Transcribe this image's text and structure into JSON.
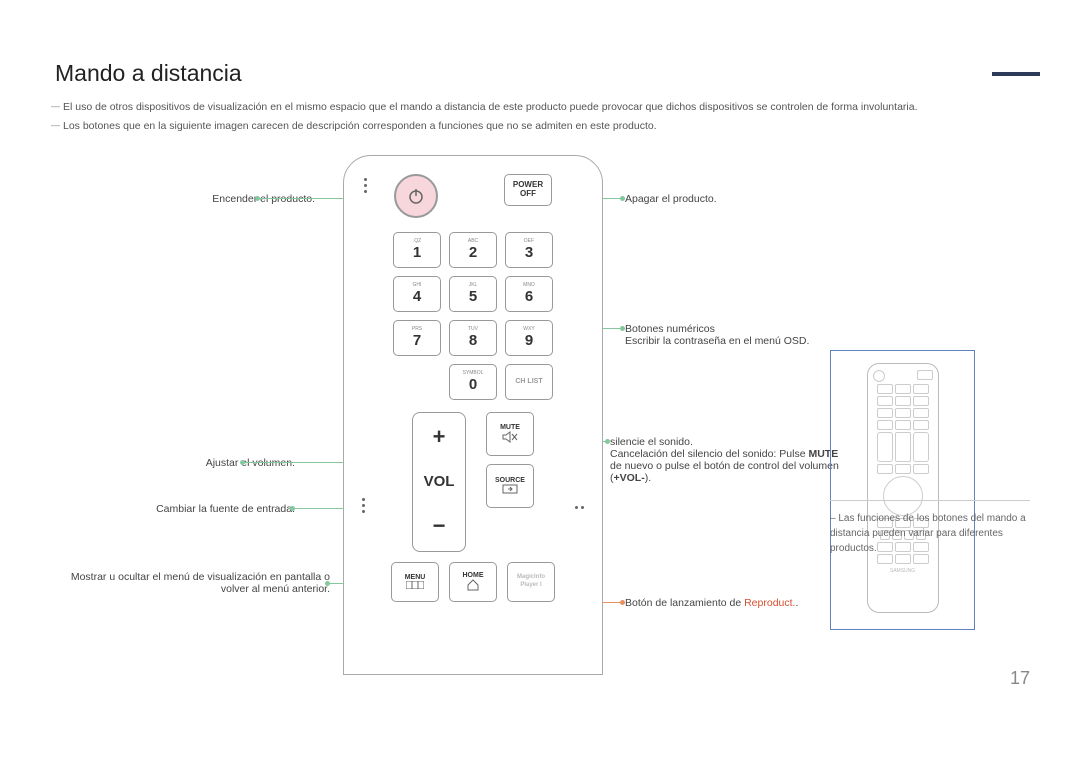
{
  "title": "Mando a distancia",
  "notes": [
    "El uso de otros dispositivos de visualización en el mismo espacio que el mando a distancia de este producto puede provocar que dichos dispositivos se controlen de forma involuntaria.",
    "Los botones que en la siguiente imagen carecen de descripción corresponden a funciones que no se admiten en este producto."
  ],
  "labels_left": {
    "power_on": "Encender el producto.",
    "volume": "Ajustar el volumen.",
    "source": "Cambiar la fuente de entrada.",
    "menu": "Mostrar u ocultar el menú de visualización en pantalla o volver al menú anterior."
  },
  "labels_right": {
    "power_off": "Apagar el producto.",
    "numeric_title": "Botones numéricos",
    "numeric_desc": "Escribir la contraseña en el menú OSD.",
    "mute_title": "silencie el sonido.",
    "mute_desc1": "Cancelación del silencio del sonido: Pulse ",
    "mute_bold": "MUTE",
    "mute_desc2": " de nuevo o pulse el botón de control del volumen (",
    "mute_vol": "+VOL-",
    "mute_desc3": ").",
    "magicinfo": "Botón de lanzamiento de ",
    "magicinfo_hi": "Reproduct.",
    "magicinfo_end": "."
  },
  "buttons": {
    "power_off": "POWER OFF",
    "k1_sub": ".QZ",
    "k1": "1",
    "k2_sub": "ABC",
    "k2": "2",
    "k3_sub": "DEF",
    "k3": "3",
    "k4_sub": "GHI",
    "k4": "4",
    "k5_sub": "JKL",
    "k5": "5",
    "k6_sub": "MNO",
    "k6": "6",
    "k7_sub": "PRS",
    "k7": "7",
    "k8_sub": "TUV",
    "k8": "8",
    "k9_sub": "WXY",
    "k9": "9",
    "k0_sub": "SYMBOL",
    "k0": "0",
    "chlist": "CH LIST",
    "vol_plus": "+",
    "vol": "VOL",
    "vol_minus": "−",
    "mute": "MUTE",
    "source": "SOURCE",
    "menu": "MENU",
    "home": "HOME",
    "magicinfo_btn": "MagicInfo Player I"
  },
  "footnote": "– Las funciones de los botones del mando a distancia pueden variar para diferentes productos.",
  "page_number": "17"
}
